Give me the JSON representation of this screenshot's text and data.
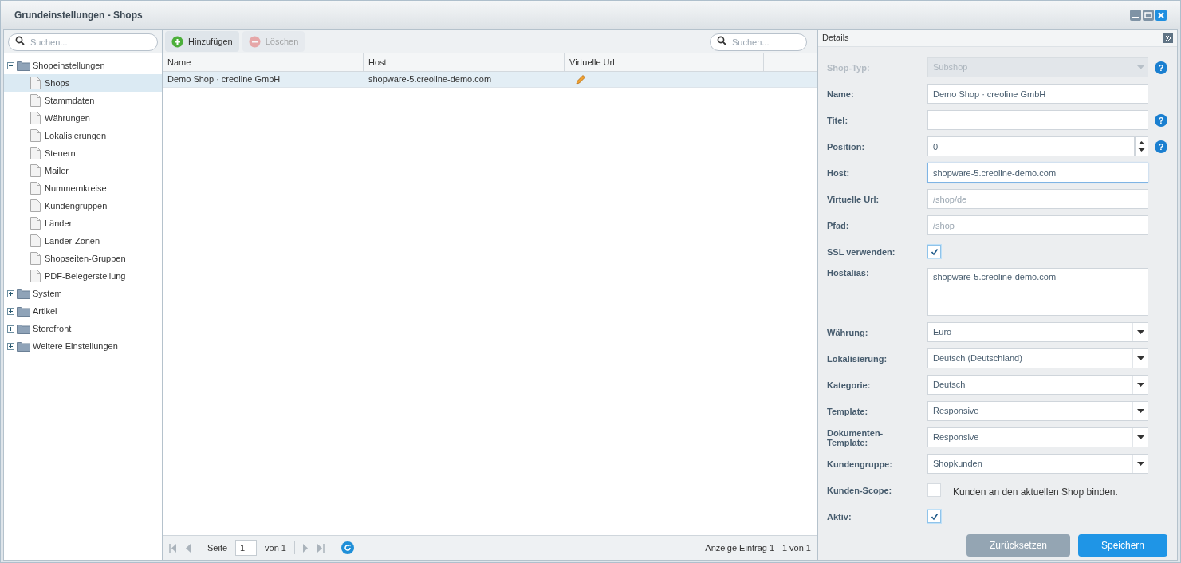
{
  "window": {
    "title": "Grundeinstellungen - Shops"
  },
  "tree": {
    "search": {
      "placeholder": "Suchen..."
    },
    "items": [
      {
        "label": "Shopeinstellungen",
        "expanded": true,
        "selected": false,
        "children": [
          {
            "label": "Shops",
            "selected": true
          },
          {
            "label": "Stammdaten",
            "selected": false
          },
          {
            "label": "Währungen",
            "selected": false
          },
          {
            "label": "Lokalisierungen",
            "selected": false
          },
          {
            "label": "Steuern",
            "selected": false
          },
          {
            "label": "Mailer",
            "selected": false
          },
          {
            "label": "Nummernkreise",
            "selected": false
          },
          {
            "label": "Kundengruppen",
            "selected": false
          },
          {
            "label": "Länder",
            "selected": false
          },
          {
            "label": "Länder-Zonen",
            "selected": false
          },
          {
            "label": "Shopseiten-Gruppen",
            "selected": false
          },
          {
            "label": "PDF-Belegerstellung",
            "selected": false
          }
        ]
      },
      {
        "label": "System",
        "expanded": false,
        "selected": false
      },
      {
        "label": "Artikel",
        "expanded": false,
        "selected": false
      },
      {
        "label": "Storefront",
        "expanded": false,
        "selected": false
      },
      {
        "label": "Weitere Einstellungen",
        "expanded": false,
        "selected": false
      }
    ]
  },
  "toolbar": {
    "buttons": [
      {
        "label": "Hinzufügen",
        "kind": "add",
        "disabled": false
      },
      {
        "label": "Löschen",
        "kind": "delete",
        "disabled": true
      }
    ],
    "search": {
      "placeholder": "Suchen..."
    }
  },
  "table": {
    "columns": [
      "Name",
      "Host",
      "Virtuelle Url"
    ],
    "rows": [
      {
        "cells": [
          "Demo Shop · creoline GmbH",
          "shopware-5.creoline-demo.com"
        ],
        "selected": true
      }
    ]
  },
  "pager": {
    "page_label": "Seite",
    "page": "1",
    "of": "von 1",
    "summary": "Anzeige Eintrag 1 - 1 von 1"
  },
  "details": {
    "title": "Details",
    "fields": [
      {
        "label": "Shop-Typ:",
        "kind": "select",
        "value": "Subshop",
        "disabled": true,
        "help": "?"
      },
      {
        "label": "Name:",
        "kind": "text",
        "value": "Demo Shop · creoline GmbH",
        "focused": false
      },
      {
        "label": "Titel:",
        "kind": "text",
        "focused": false,
        "help": "?"
      },
      {
        "label": "Position:",
        "kind": "number",
        "value": "0",
        "focused": false,
        "help": "?"
      },
      {
        "label": "Host:",
        "kind": "text",
        "value": "shopware-5.creoline-demo.com",
        "focused": true
      },
      {
        "label": "Virtuelle Url:",
        "kind": "text",
        "placeholder": "/shop/de",
        "focused": false
      },
      {
        "label": "Pfad:",
        "kind": "text",
        "placeholder": "/shop",
        "focused": false
      },
      {
        "label": "SSL verwenden:",
        "kind": "checkbox",
        "checked": true
      },
      {
        "label": "Hostalias:",
        "kind": "textarea",
        "value": "shopware-5.creoline-demo.com"
      },
      {
        "label": "Währung:",
        "kind": "select",
        "value": "Euro",
        "disabled": false
      },
      {
        "label": "Lokalisierung:",
        "kind": "select",
        "value": "Deutsch (Deutschland)",
        "disabled": false
      },
      {
        "label": "Kategorie:",
        "kind": "select",
        "value": "Deutsch",
        "disabled": false
      },
      {
        "label": "Template:",
        "kind": "select",
        "value": "Responsive",
        "disabled": false
      },
      {
        "label": "Dokumenten-Template:",
        "kind": "select",
        "value": "Responsive",
        "disabled": false
      },
      {
        "label": "Kundengruppe:",
        "kind": "select",
        "value": "Shopkunden",
        "disabled": false
      },
      {
        "label": "Kunden-Scope:",
        "kind": "checkbox",
        "checked": false,
        "box_label": "Kunden an den aktuellen Shop binden."
      },
      {
        "label": "Aktiv:",
        "kind": "checkbox",
        "checked": true
      }
    ],
    "buttons": [
      {
        "label": "Zurücksetzen",
        "kind": "secondary"
      },
      {
        "label": "Speichern",
        "kind": "primary"
      }
    ]
  }
}
